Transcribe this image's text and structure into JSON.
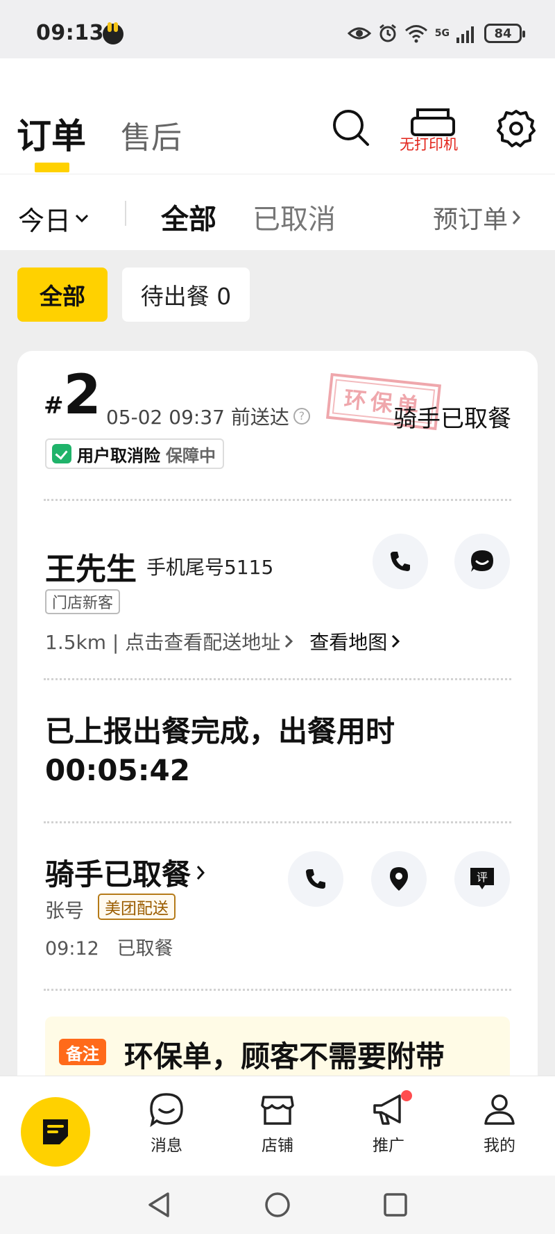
{
  "status_bar": {
    "time": "09:13",
    "battery": "84",
    "network": "5G",
    "icons": [
      "bunny-icon",
      "eye-icon",
      "alarm-icon",
      "wifi-icon",
      "signal-icon",
      "battery-icon"
    ]
  },
  "header": {
    "tabs": [
      {
        "label": "订单",
        "active": true
      },
      {
        "label": "售后",
        "active": false
      }
    ],
    "printer_status": "无打印机",
    "icons": [
      "search-icon",
      "printer-icon",
      "gear-icon"
    ],
    "accent_color": "#ffd100"
  },
  "filter_bar": {
    "date": "今日",
    "tabs": [
      {
        "label": "全部",
        "active": true
      },
      {
        "label": "已取消",
        "active": false
      }
    ],
    "preorder": "预订单"
  },
  "chips": [
    {
      "label": "全部",
      "active": true
    },
    {
      "label": "待出餐 0",
      "active": false
    }
  ],
  "order": {
    "hash": "#",
    "number": "2",
    "deliver_time": "05-02 09:37 前送达",
    "help_mark": "?",
    "stamp": "环保单",
    "status": "骑手已取餐",
    "insurance_label": "用户取消险",
    "insurance_status": "保障中",
    "customer": {
      "name": "王先生",
      "phone": "手机尾号5115",
      "tag": "门店新客",
      "distance_address": "1.5km | 点击查看配送地址",
      "map_link": "查看地图"
    },
    "report_line1": "已上报出餐完成，出餐用时",
    "report_line2": "00:05:42",
    "rider": {
      "title": "骑手已取餐",
      "name": "张号",
      "tag": "美团配送",
      "time": "09:12",
      "time_status": "已取餐"
    },
    "remark_tag": "备注",
    "remark_text": "环保单，顾客不需要附带"
  },
  "bottom_nav": {
    "items": [
      {
        "label": "消息",
        "icon": "message-icon"
      },
      {
        "label": "店铺",
        "icon": "store-icon"
      },
      {
        "label": "推广",
        "icon": "megaphone-icon",
        "badge": true
      },
      {
        "label": "我的",
        "icon": "profile-icon"
      }
    ],
    "fab_icon": "orders-note-icon"
  },
  "system_nav": [
    "back-icon",
    "home-icon",
    "recents-icon"
  ]
}
